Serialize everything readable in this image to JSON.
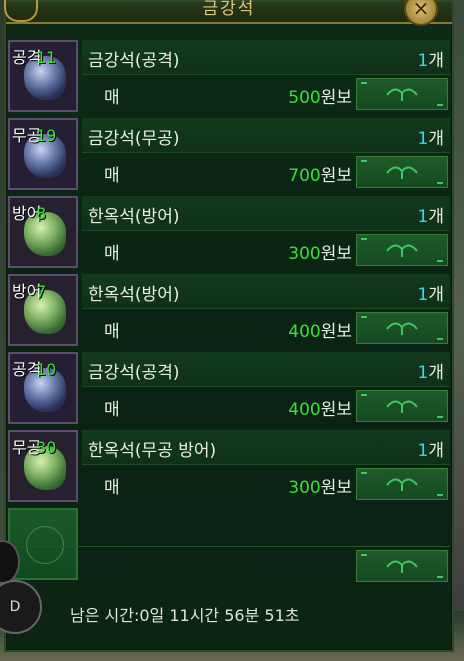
{
  "window": {
    "title": "금강석",
    "close_label": "×"
  },
  "unit_count": "개",
  "unit_price": "원보",
  "sell_label": "매",
  "items": [
    {
      "tag": "공격",
      "qty": "11",
      "gem": "diamond",
      "name": "금강석(공격)",
      "count": "1",
      "price": "500"
    },
    {
      "tag": "무공",
      "qty": "19",
      "gem": "diamond",
      "name": "금강석(무공)",
      "count": "1",
      "price": "700"
    },
    {
      "tag": "방어",
      "qty": "8",
      "gem": "jade",
      "name": "한옥석(방어)",
      "count": "1",
      "price": "300"
    },
    {
      "tag": "방어",
      "qty": "7",
      "gem": "jade",
      "name": "한옥석(방어)",
      "count": "1",
      "price": "400"
    },
    {
      "tag": "공격",
      "qty": "10",
      "gem": "diamond",
      "name": "금강석(공격)",
      "count": "1",
      "price": "400"
    },
    {
      "tag": "무공",
      "qty": "30",
      "gem": "jade",
      "name": "한옥석(무공 방어)",
      "count": "1",
      "price": "300"
    }
  ],
  "timer": "남은 시간:0일 11시간 56분 51초",
  "side_button": "D",
  "colors": {
    "qty_green": "#38e038",
    "count_cyan": "#38d8e8",
    "panel_bg": "#0d2a17"
  }
}
